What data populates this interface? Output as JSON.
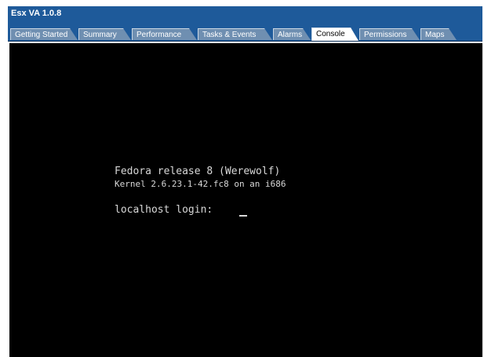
{
  "window": {
    "title": "Esx VA 1.0.8"
  },
  "tabs": [
    {
      "label": "Getting Started",
      "active": false
    },
    {
      "label": "Summary",
      "active": false
    },
    {
      "label": "Performance",
      "active": false
    },
    {
      "label": "Tasks & Events",
      "active": false
    },
    {
      "label": "Alarms",
      "active": false
    },
    {
      "label": "Console",
      "active": true
    },
    {
      "label": "Permissions",
      "active": false
    },
    {
      "label": "Maps",
      "active": false
    }
  ],
  "console": {
    "release_line": "Fedora release 8 (Werewolf)",
    "kernel_line": "Kernel 2.6.23.1-42.fc8 on an i686",
    "login_prompt": "localhost login:"
  },
  "colors": {
    "titlebar": "#1e5a9a",
    "tab_inactive": "#6f8fb1",
    "tab_active": "#ffffff",
    "console_bg": "#000000",
    "console_fg": "#d8d8d8"
  }
}
